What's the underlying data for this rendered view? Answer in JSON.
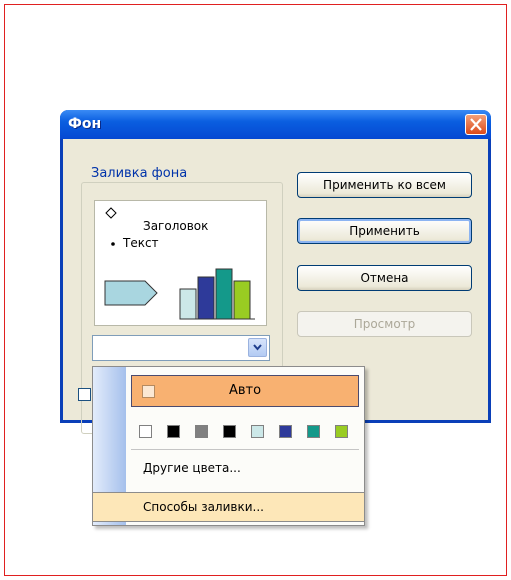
{
  "dialog": {
    "title": "Фон",
    "group_label": "Заливка фона",
    "preview": {
      "heading": "Заголовок",
      "bullet_text": "Текст"
    },
    "buttons": {
      "apply_all": "Применить ко всем",
      "apply": "Применить",
      "cancel": "Отмена",
      "preview": "Просмотр"
    }
  },
  "menu": {
    "auto_label": "Авто",
    "more_colors": "Другие цвета...",
    "fill_effects": "Способы заливки...",
    "swatch_colors": [
      "#ffffff",
      "#000000",
      "#808080",
      "#000000",
      "#cce8e8",
      "#2e3a9a",
      "#14998a",
      "#99cc22"
    ]
  },
  "colors": {
    "accent_title": "#0a5ee0",
    "menu_highlight": "#f8b171",
    "chart_bars": [
      "#2e3a9a",
      "#14998a",
      "#99cc22"
    ]
  }
}
